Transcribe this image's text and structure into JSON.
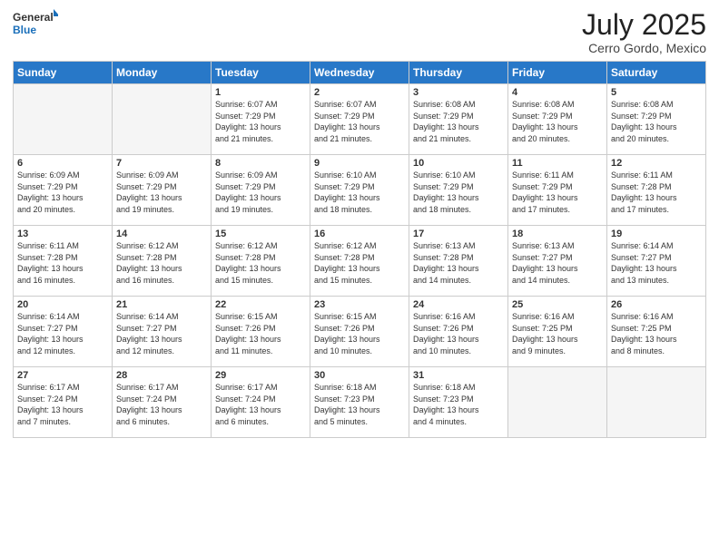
{
  "header": {
    "logo_general": "General",
    "logo_blue": "Blue",
    "month_title": "July 2025",
    "location": "Cerro Gordo, Mexico"
  },
  "days_of_week": [
    "Sunday",
    "Monday",
    "Tuesday",
    "Wednesday",
    "Thursday",
    "Friday",
    "Saturday"
  ],
  "weeks": [
    [
      {
        "day": "",
        "info": ""
      },
      {
        "day": "",
        "info": ""
      },
      {
        "day": "1",
        "info": "Sunrise: 6:07 AM\nSunset: 7:29 PM\nDaylight: 13 hours\nand 21 minutes."
      },
      {
        "day": "2",
        "info": "Sunrise: 6:07 AM\nSunset: 7:29 PM\nDaylight: 13 hours\nand 21 minutes."
      },
      {
        "day": "3",
        "info": "Sunrise: 6:08 AM\nSunset: 7:29 PM\nDaylight: 13 hours\nand 21 minutes."
      },
      {
        "day": "4",
        "info": "Sunrise: 6:08 AM\nSunset: 7:29 PM\nDaylight: 13 hours\nand 20 minutes."
      },
      {
        "day": "5",
        "info": "Sunrise: 6:08 AM\nSunset: 7:29 PM\nDaylight: 13 hours\nand 20 minutes."
      }
    ],
    [
      {
        "day": "6",
        "info": "Sunrise: 6:09 AM\nSunset: 7:29 PM\nDaylight: 13 hours\nand 20 minutes."
      },
      {
        "day": "7",
        "info": "Sunrise: 6:09 AM\nSunset: 7:29 PM\nDaylight: 13 hours\nand 19 minutes."
      },
      {
        "day": "8",
        "info": "Sunrise: 6:09 AM\nSunset: 7:29 PM\nDaylight: 13 hours\nand 19 minutes."
      },
      {
        "day": "9",
        "info": "Sunrise: 6:10 AM\nSunset: 7:29 PM\nDaylight: 13 hours\nand 18 minutes."
      },
      {
        "day": "10",
        "info": "Sunrise: 6:10 AM\nSunset: 7:29 PM\nDaylight: 13 hours\nand 18 minutes."
      },
      {
        "day": "11",
        "info": "Sunrise: 6:11 AM\nSunset: 7:29 PM\nDaylight: 13 hours\nand 17 minutes."
      },
      {
        "day": "12",
        "info": "Sunrise: 6:11 AM\nSunset: 7:28 PM\nDaylight: 13 hours\nand 17 minutes."
      }
    ],
    [
      {
        "day": "13",
        "info": "Sunrise: 6:11 AM\nSunset: 7:28 PM\nDaylight: 13 hours\nand 16 minutes."
      },
      {
        "day": "14",
        "info": "Sunrise: 6:12 AM\nSunset: 7:28 PM\nDaylight: 13 hours\nand 16 minutes."
      },
      {
        "day": "15",
        "info": "Sunrise: 6:12 AM\nSunset: 7:28 PM\nDaylight: 13 hours\nand 15 minutes."
      },
      {
        "day": "16",
        "info": "Sunrise: 6:12 AM\nSunset: 7:28 PM\nDaylight: 13 hours\nand 15 minutes."
      },
      {
        "day": "17",
        "info": "Sunrise: 6:13 AM\nSunset: 7:28 PM\nDaylight: 13 hours\nand 14 minutes."
      },
      {
        "day": "18",
        "info": "Sunrise: 6:13 AM\nSunset: 7:27 PM\nDaylight: 13 hours\nand 14 minutes."
      },
      {
        "day": "19",
        "info": "Sunrise: 6:14 AM\nSunset: 7:27 PM\nDaylight: 13 hours\nand 13 minutes."
      }
    ],
    [
      {
        "day": "20",
        "info": "Sunrise: 6:14 AM\nSunset: 7:27 PM\nDaylight: 13 hours\nand 12 minutes."
      },
      {
        "day": "21",
        "info": "Sunrise: 6:14 AM\nSunset: 7:27 PM\nDaylight: 13 hours\nand 12 minutes."
      },
      {
        "day": "22",
        "info": "Sunrise: 6:15 AM\nSunset: 7:26 PM\nDaylight: 13 hours\nand 11 minutes."
      },
      {
        "day": "23",
        "info": "Sunrise: 6:15 AM\nSunset: 7:26 PM\nDaylight: 13 hours\nand 10 minutes."
      },
      {
        "day": "24",
        "info": "Sunrise: 6:16 AM\nSunset: 7:26 PM\nDaylight: 13 hours\nand 10 minutes."
      },
      {
        "day": "25",
        "info": "Sunrise: 6:16 AM\nSunset: 7:25 PM\nDaylight: 13 hours\nand 9 minutes."
      },
      {
        "day": "26",
        "info": "Sunrise: 6:16 AM\nSunset: 7:25 PM\nDaylight: 13 hours\nand 8 minutes."
      }
    ],
    [
      {
        "day": "27",
        "info": "Sunrise: 6:17 AM\nSunset: 7:24 PM\nDaylight: 13 hours\nand 7 minutes."
      },
      {
        "day": "28",
        "info": "Sunrise: 6:17 AM\nSunset: 7:24 PM\nDaylight: 13 hours\nand 6 minutes."
      },
      {
        "day": "29",
        "info": "Sunrise: 6:17 AM\nSunset: 7:24 PM\nDaylight: 13 hours\nand 6 minutes."
      },
      {
        "day": "30",
        "info": "Sunrise: 6:18 AM\nSunset: 7:23 PM\nDaylight: 13 hours\nand 5 minutes."
      },
      {
        "day": "31",
        "info": "Sunrise: 6:18 AM\nSunset: 7:23 PM\nDaylight: 13 hours\nand 4 minutes."
      },
      {
        "day": "",
        "info": ""
      },
      {
        "day": "",
        "info": ""
      }
    ]
  ]
}
